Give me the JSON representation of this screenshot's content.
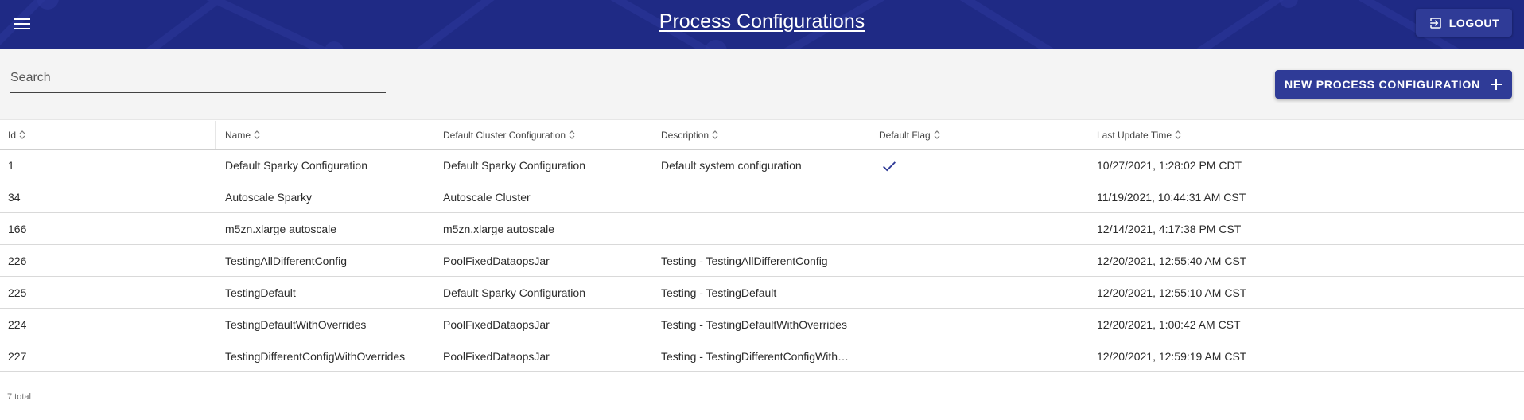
{
  "header": {
    "title": "Process Configurations",
    "logout_label": "LOGOUT",
    "bg_color": "#1f2a85",
    "menu_icon": "hamburger-menu-icon",
    "logout_icon": "exit-to-app-icon"
  },
  "toolbar": {
    "search_placeholder": "Search",
    "search_value": "",
    "new_button_label": "NEW PROCESS CONFIGURATION",
    "new_button_icon": "plus-icon",
    "accent_color": "#2f3b97"
  },
  "table": {
    "columns": [
      {
        "label": "Id"
      },
      {
        "label": "Name"
      },
      {
        "label": "Default Cluster Configuration"
      },
      {
        "label": "Description"
      },
      {
        "label": "Default Flag"
      },
      {
        "label": "Last Update Time"
      }
    ],
    "rows": [
      {
        "id": "1",
        "name": "Default Sparky Configuration",
        "cluster": "Default Sparky Configuration",
        "description": "Default system configuration",
        "default_flag": true,
        "updated": "10/27/2021, 1:28:02 PM CDT"
      },
      {
        "id": "34",
        "name": "Autoscale Sparky",
        "cluster": "Autoscale Cluster",
        "description": "",
        "default_flag": false,
        "updated": "11/19/2021, 10:44:31 AM CST"
      },
      {
        "id": "166",
        "name": "m5zn.xlarge autoscale",
        "cluster": "m5zn.xlarge autoscale",
        "description": "",
        "default_flag": false,
        "updated": "12/14/2021, 4:17:38 PM CST"
      },
      {
        "id": "226",
        "name": "TestingAllDifferentConfig",
        "cluster": "PoolFixedDataopsJar",
        "description": "Testing - TestingAllDifferentConfig",
        "default_flag": false,
        "updated": "12/20/2021, 12:55:40 AM CST"
      },
      {
        "id": "225",
        "name": "TestingDefault",
        "cluster": "Default Sparky Configuration",
        "description": "Testing - TestingDefault",
        "default_flag": false,
        "updated": "12/20/2021, 12:55:10 AM CST"
      },
      {
        "id": "224",
        "name": "TestingDefaultWithOverrides",
        "cluster": "PoolFixedDataopsJar",
        "description": "Testing - TestingDefaultWithOverrides",
        "default_flag": false,
        "updated": "12/20/2021, 1:00:42 AM CST"
      },
      {
        "id": "227",
        "name": "TestingDifferentConfigWithOverrides",
        "cluster": "PoolFixedDataopsJar",
        "description": "Testing - TestingDifferentConfigWithOverrides",
        "default_flag": false,
        "updated": "12/20/2021, 12:59:19 AM CST"
      }
    ],
    "check_icon": "checkmark-icon",
    "check_color": "#2f3b97"
  },
  "footer": {
    "total_label": "7 total"
  }
}
